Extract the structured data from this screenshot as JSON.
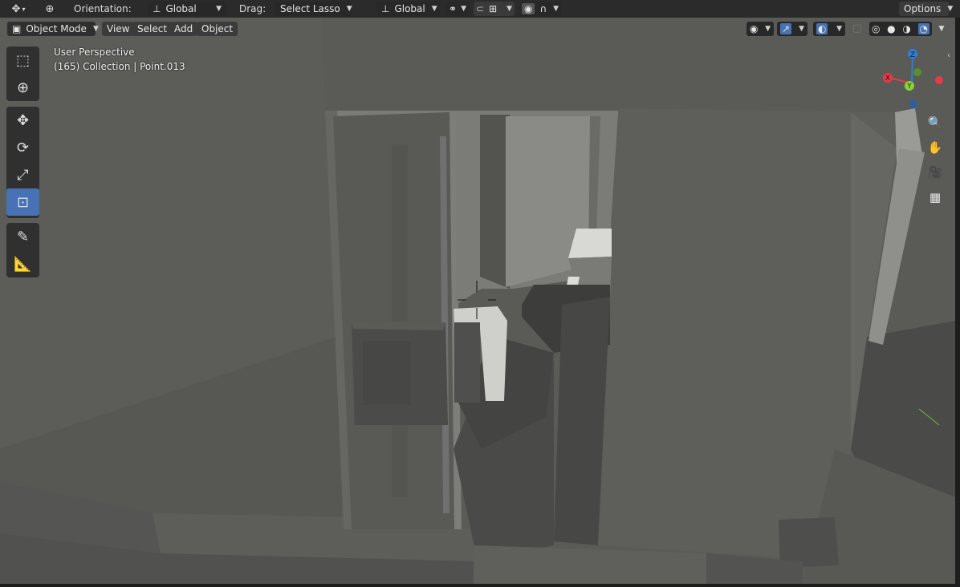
{
  "topbar": {
    "orientation_label": "Orientation:",
    "orientation_value": "Global",
    "drag_label": "Drag:",
    "drag_value": "Select Lasso",
    "pivot_value": "Global",
    "options_label": "Options"
  },
  "header": {
    "mode": "Object Mode",
    "menus": [
      "View",
      "Select",
      "Add",
      "Object"
    ]
  },
  "overlay": {
    "view_name": "User Perspective",
    "collection_info": "(165) Collection | Point.013"
  },
  "gizmo": {
    "z": "Z",
    "y": "Y",
    "x": "X"
  },
  "colors": {
    "accent": "#4772b3",
    "axis_x": "#e8394a",
    "axis_y": "#8bd138",
    "axis_z": "#2f7fd6"
  }
}
